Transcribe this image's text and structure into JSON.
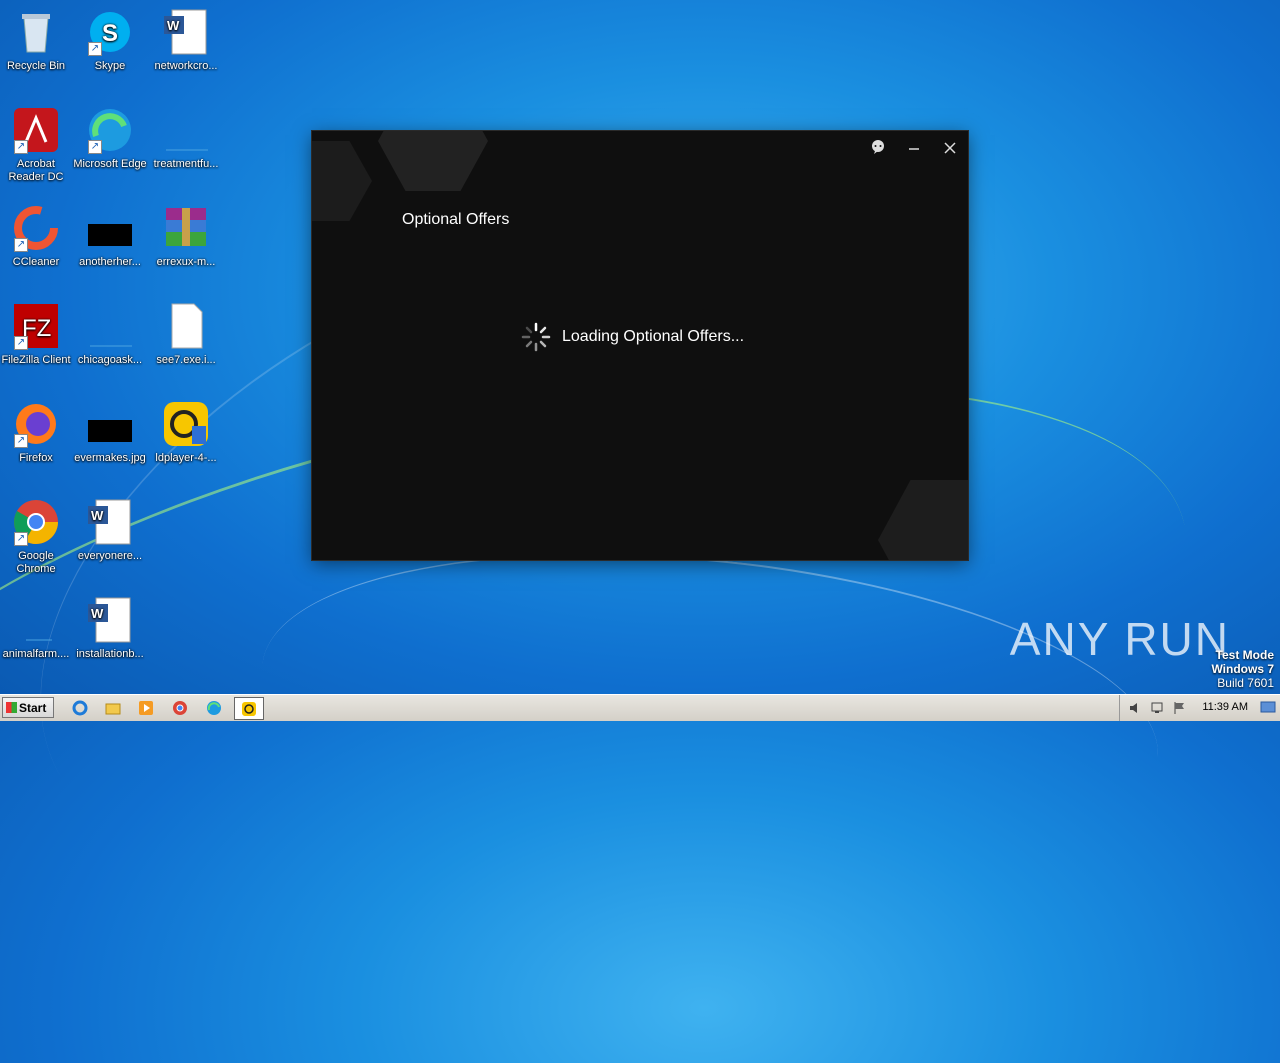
{
  "desktop": {
    "icons": [
      {
        "label": "Recycle Bin",
        "icon": "recycle-bin-icon"
      },
      {
        "label": "Skype",
        "icon": "skype-icon"
      },
      {
        "label": "networkcro...",
        "icon": "word-doc-icon"
      },
      {
        "label": "Acrobat Reader DC",
        "icon": "acrobat-icon"
      },
      {
        "label": "Microsoft Edge",
        "icon": "edge-icon"
      },
      {
        "label": "treatmentfu...",
        "icon": "blank-file-icon"
      },
      {
        "label": "CCleaner",
        "icon": "ccleaner-icon"
      },
      {
        "label": "anotherher...",
        "icon": "black-image-icon"
      },
      {
        "label": "errexux-m...",
        "icon": "winrar-icon"
      },
      {
        "label": "FileZilla Client",
        "icon": "filezilla-icon"
      },
      {
        "label": "chicagoask...",
        "icon": "blank-file-icon"
      },
      {
        "label": "see7.exe.i...",
        "icon": "generic-file-icon"
      },
      {
        "label": "Firefox",
        "icon": "firefox-icon"
      },
      {
        "label": "evermakes.jpg",
        "icon": "black-image-icon"
      },
      {
        "label": "ldplayer-4-...",
        "icon": "ldplayer-icon"
      },
      {
        "label": "Google Chrome",
        "icon": "chrome-icon"
      },
      {
        "label": "everyonere...",
        "icon": "word-doc-icon"
      },
      {
        "label": "animalfarm....",
        "icon": "blank-file-icon"
      },
      {
        "label": "installationb...",
        "icon": "word-doc-icon"
      }
    ]
  },
  "window": {
    "title": "Optional Offers",
    "loading_text": "Loading Optional Offers...",
    "controls": {
      "feedback": "feedback-icon",
      "minimize": "minimize-icon",
      "close": "close-icon"
    },
    "background": "#0f0f0f"
  },
  "taskbar": {
    "start_label": "Start",
    "clock": "11:39 AM",
    "pinned": [
      "internet-explorer-icon",
      "explorer-folder-icon",
      "media-player-icon",
      "chrome-icon",
      "edge-icon",
      "ldplayer-icon"
    ]
  },
  "watermark": {
    "brand": "ANY RUN",
    "line1": "Test Mode",
    "line2": "Windows 7",
    "line3": "Build 7601"
  }
}
